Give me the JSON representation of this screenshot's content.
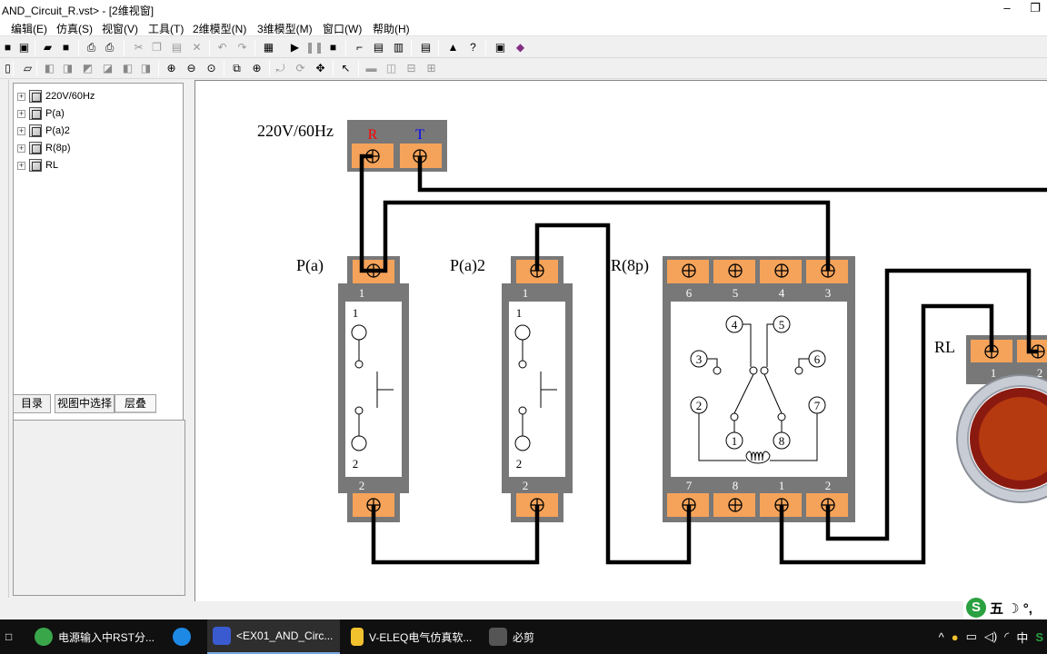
{
  "window": {
    "title": "AND_Circuit_R.vst> - [2维视窗]",
    "minimize_glyph": "–",
    "restore_glyph": "❐"
  },
  "menu": [
    "编辑(E)",
    "仿真(S)",
    "视窗(V)",
    "工具(T)",
    "2维模型(N)",
    "3维模型(M)",
    "窗口(W)",
    "帮助(H)"
  ],
  "tree": {
    "items": [
      {
        "label": "220V/60Hz"
      },
      {
        "label": "P(a)"
      },
      {
        "label": "P(a)2"
      },
      {
        "label": "R(8p)"
      },
      {
        "label": "RL"
      }
    ],
    "expander_glyph": "+"
  },
  "tabs": [
    "目录",
    "视图中选择",
    "层叠"
  ],
  "diagram": {
    "source": {
      "name": "220V/60Hz",
      "term_r": "R",
      "term_t": "T"
    },
    "switch1": {
      "name": "P(a)",
      "top_pin": "1",
      "bottom_pin": "2",
      "contact_top": "1",
      "contact_bottom": "2"
    },
    "switch2": {
      "name": "P(a)2",
      "top_pin": "1",
      "bottom_pin": "2",
      "contact_top": "1",
      "contact_bottom": "2"
    },
    "relay": {
      "name": "R(8p)",
      "top_pins": [
        "6",
        "5",
        "4",
        "3"
      ],
      "bottom_pins": [
        "7",
        "8",
        "1",
        "2"
      ],
      "inner_pins": [
        "4",
        "5",
        "3",
        "6",
        "2",
        "7",
        "1",
        "8"
      ]
    },
    "lamp": {
      "name": "RL",
      "pins": [
        "1",
        "2"
      ]
    },
    "colors": {
      "terminal": "#f5a35a",
      "housing": "#787878",
      "wire": "#000000",
      "lamp_red": "#b63a0f",
      "term_r_color": "#ff0000",
      "term_t_color": "#0000ff"
    }
  },
  "ime": {
    "glyphs": "五 ☽ °,",
    "logo": "S"
  },
  "taskbar": {
    "start_glyph": "□",
    "items": [
      {
        "label": "电源输入中RST分...",
        "icon_color": "#3aa64a"
      },
      {
        "label": "",
        "icon_color": "#1e88e5"
      },
      {
        "label": "<EX01_AND_Circ...",
        "icon_color": "#3a5bd0"
      },
      {
        "label": "V-ELEQ电气仿真软...",
        "icon_color": "#f2c12e"
      },
      {
        "label": "必剪",
        "icon_color": "#555555"
      }
    ],
    "tray": {
      "chevron": "^",
      "lang": "中",
      "s_logo": "S"
    }
  }
}
